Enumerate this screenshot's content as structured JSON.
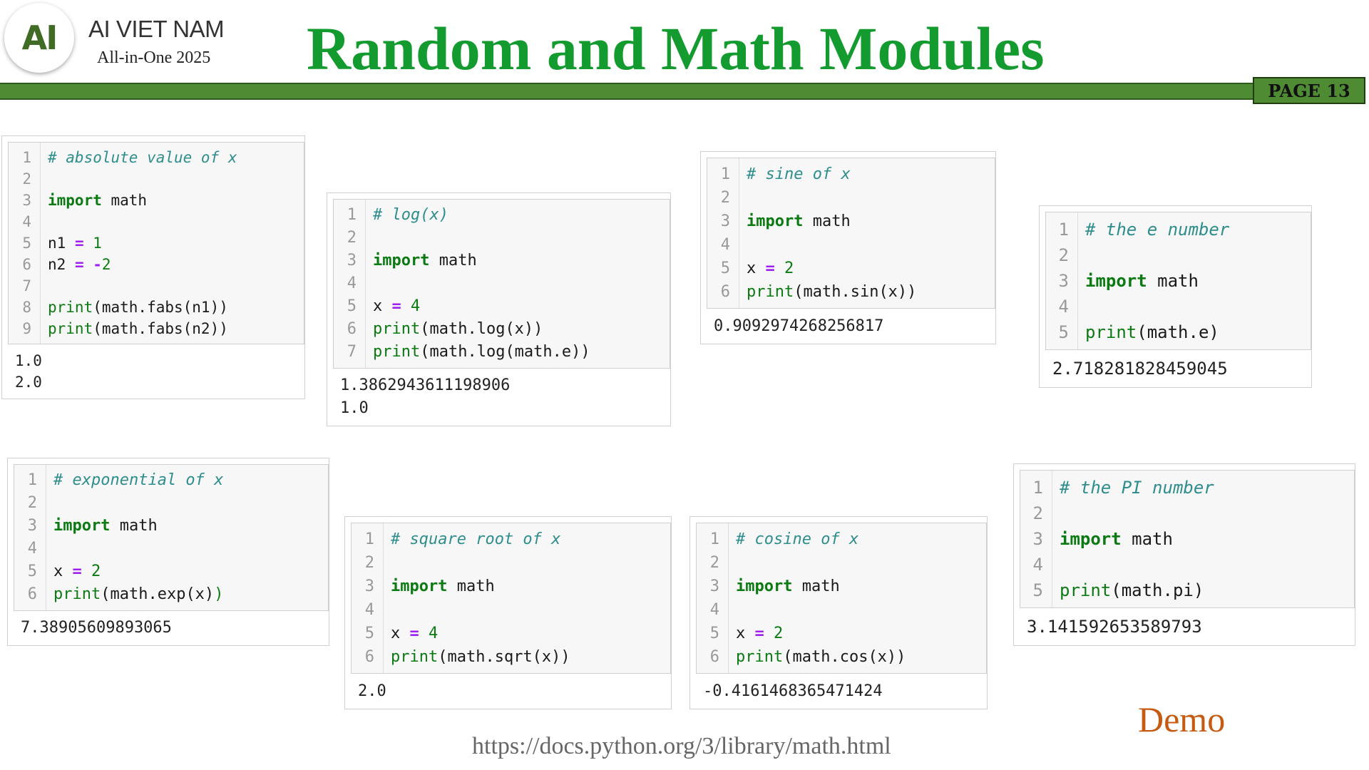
{
  "header": {
    "logo_text": "AI",
    "brand_name": "AI VIET NAM",
    "brand_sub": "All-in-One 2025",
    "title": "Random and Math Modules",
    "page_badge": "PAGE 13"
  },
  "colors": {
    "title": "#149b2f",
    "bar": "#4f8b33",
    "demo": "#c55a11"
  },
  "cells": [
    {
      "id": "fabs",
      "lines": [
        [
          [
            "cm",
            "# absolute value of x"
          ]
        ],
        [],
        [
          [
            "kw",
            "import"
          ],
          [
            "",
            " math"
          ]
        ],
        [],
        [
          [
            "",
            "n1 "
          ],
          [
            "op",
            "="
          ],
          [
            "",
            " "
          ],
          [
            "nm",
            "1"
          ]
        ],
        [
          [
            "",
            "n2 "
          ],
          [
            "op",
            "="
          ],
          [
            "",
            " "
          ],
          [
            "op",
            "-"
          ],
          [
            "nm",
            "2"
          ]
        ],
        [],
        [
          [
            "fn",
            "print"
          ],
          [
            "",
            "(math.fabs(n1))"
          ]
        ],
        [
          [
            "fn",
            "print"
          ],
          [
            "",
            "(math.fabs(n2))"
          ]
        ]
      ],
      "output": "1.0\n2.0"
    },
    {
      "id": "log",
      "lines": [
        [
          [
            "cm",
            "# log(x)"
          ]
        ],
        [],
        [
          [
            "kw",
            "import"
          ],
          [
            "",
            " math"
          ]
        ],
        [],
        [
          [
            "",
            "x "
          ],
          [
            "op",
            "="
          ],
          [
            "",
            " "
          ],
          [
            "nm",
            "4"
          ]
        ],
        [
          [
            "fn",
            "print"
          ],
          [
            "",
            "(math.log(x))"
          ]
        ],
        [
          [
            "fn",
            "print"
          ],
          [
            "",
            "(math.log(math.e))"
          ]
        ]
      ],
      "output": "1.3862943611198906\n1.0"
    },
    {
      "id": "sin",
      "lines": [
        [
          [
            "cm",
            "# sine of x"
          ]
        ],
        [],
        [
          [
            "kw",
            "import"
          ],
          [
            "",
            " math"
          ]
        ],
        [],
        [
          [
            "",
            "x "
          ],
          [
            "op",
            "="
          ],
          [
            "",
            " "
          ],
          [
            "nm",
            "2"
          ]
        ],
        [
          [
            "fn",
            "print"
          ],
          [
            "",
            "(math.sin(x))"
          ]
        ]
      ],
      "output": "0.9092974268256817"
    },
    {
      "id": "e",
      "lines": [
        [
          [
            "cm",
            "# the e number"
          ]
        ],
        [],
        [
          [
            "kw",
            "import"
          ],
          [
            "",
            " math"
          ]
        ],
        [],
        [
          [
            "fn",
            "print"
          ],
          [
            "",
            "(math.e)"
          ]
        ]
      ],
      "output": "2.718281828459045"
    },
    {
      "id": "exp",
      "lines": [
        [
          [
            "cm",
            "# exponential of x"
          ]
        ],
        [],
        [
          [
            "kw",
            "import"
          ],
          [
            "",
            " math"
          ]
        ],
        [],
        [
          [
            "",
            "x "
          ],
          [
            "op",
            "="
          ],
          [
            "",
            " "
          ],
          [
            "nm",
            "2"
          ]
        ],
        [
          [
            "fn",
            "print"
          ],
          [
            "",
            "(math.exp(x)"
          ],
          [
            "fn",
            ")"
          ]
        ]
      ],
      "output": "7.38905609893065"
    },
    {
      "id": "sqrt",
      "lines": [
        [
          [
            "cm",
            "# square root of x"
          ]
        ],
        [],
        [
          [
            "kw",
            "import"
          ],
          [
            "",
            " math"
          ]
        ],
        [],
        [
          [
            "",
            "x "
          ],
          [
            "op",
            "="
          ],
          [
            "",
            " "
          ],
          [
            "nm",
            "4"
          ]
        ],
        [
          [
            "fn",
            "print"
          ],
          [
            "",
            "(math.sqrt(x))"
          ]
        ]
      ],
      "output": "2.0"
    },
    {
      "id": "cos",
      "lines": [
        [
          [
            "cm",
            "# cosine of x"
          ]
        ],
        [],
        [
          [
            "kw",
            "import"
          ],
          [
            "",
            " math"
          ]
        ],
        [],
        [
          [
            "",
            "x "
          ],
          [
            "op",
            "="
          ],
          [
            "",
            " "
          ],
          [
            "nm",
            "2"
          ]
        ],
        [
          [
            "fn",
            "print"
          ],
          [
            "",
            "(math.cos(x))"
          ]
        ]
      ],
      "output": "-0.4161468365471424"
    },
    {
      "id": "pi",
      "lines": [
        [
          [
            "cm",
            "# the PI number"
          ]
        ],
        [],
        [
          [
            "kw",
            "import"
          ],
          [
            "",
            " math"
          ]
        ],
        [],
        [
          [
            "fn",
            "print"
          ],
          [
            "",
            "(math.pi)"
          ]
        ]
      ],
      "output": "3.141592653589793"
    }
  ],
  "footer": {
    "demo": "Demo",
    "link": "https://docs.python.org/3/library/math.html"
  }
}
